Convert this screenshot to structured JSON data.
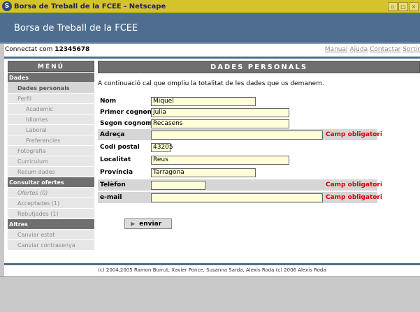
{
  "window": {
    "title": "Borsa de Treball de la FCEE - Netscape",
    "app_icon": "S",
    "controls": [
      "▫",
      "□",
      "×"
    ]
  },
  "header": {
    "title": "Borsa de Treball de la FCEE"
  },
  "userbar": {
    "connected_label": "Connectat com",
    "user_id": "12345678",
    "links": [
      "Manual",
      "Ajuda",
      "Contactar",
      "Sortir"
    ]
  },
  "menu": {
    "title": "MENÚ",
    "items": [
      {
        "label": "Dades",
        "kind": "sec"
      },
      {
        "label": "Dades personals",
        "kind": "sub active"
      },
      {
        "label": "Perfil",
        "kind": "sub"
      },
      {
        "label": "Academic",
        "kind": "sub2"
      },
      {
        "label": "Idiomes",
        "kind": "sub2"
      },
      {
        "label": "Laboral",
        "kind": "sub2"
      },
      {
        "label": "Preferencies",
        "kind": "sub2"
      },
      {
        "label": "Fotografia",
        "kind": "sub"
      },
      {
        "label": "Curriculum",
        "kind": "sub"
      },
      {
        "label": "Resum dades",
        "kind": "sub"
      },
      {
        "label": "Consultar ofertes",
        "kind": "sec"
      },
      {
        "label": "Ofertes (0)",
        "kind": "sub italic"
      },
      {
        "label": "Acceptades (1)",
        "kind": "sub"
      },
      {
        "label": "Rebutjades (1)",
        "kind": "sub"
      },
      {
        "label": "Altres",
        "kind": "sec"
      },
      {
        "label": "Canviar estat",
        "kind": "sub"
      },
      {
        "label": "Canviar contrasenya",
        "kind": "sub"
      }
    ]
  },
  "panel": {
    "title": "DADES PERSONALS",
    "intro": "A continuació cal que ompliu la totalitat de les dades que us demanem.",
    "fields": [
      {
        "label": "Nom",
        "value": "Miquel",
        "required_msg": ""
      },
      {
        "label": "Primer cognom",
        "value": "Julia",
        "required_msg": ""
      },
      {
        "label": "Segon cognom",
        "value": "Recasens",
        "required_msg": ""
      },
      {
        "label": "Adreça",
        "value": "",
        "required_msg": "Camp obligatori"
      },
      {
        "label": "Codi postal",
        "value": "43205",
        "required_msg": ""
      },
      {
        "label": "Localitat",
        "value": "Reus",
        "required_msg": ""
      },
      {
        "label": "Província",
        "value": "Tarragona",
        "required_msg": ""
      },
      {
        "label": "Telèfon",
        "value": "",
        "required_msg": "Camp obligatori"
      },
      {
        "label": "e-mail",
        "value": "",
        "required_msg": "Camp obligatori"
      }
    ],
    "submit_label": "enviar"
  },
  "footer": "(c) 2004,2005 Ramon Burrut, Xavier Ponce, Susanna Sarda, Alexis Roda (c) 2006 Alexis Roda"
}
